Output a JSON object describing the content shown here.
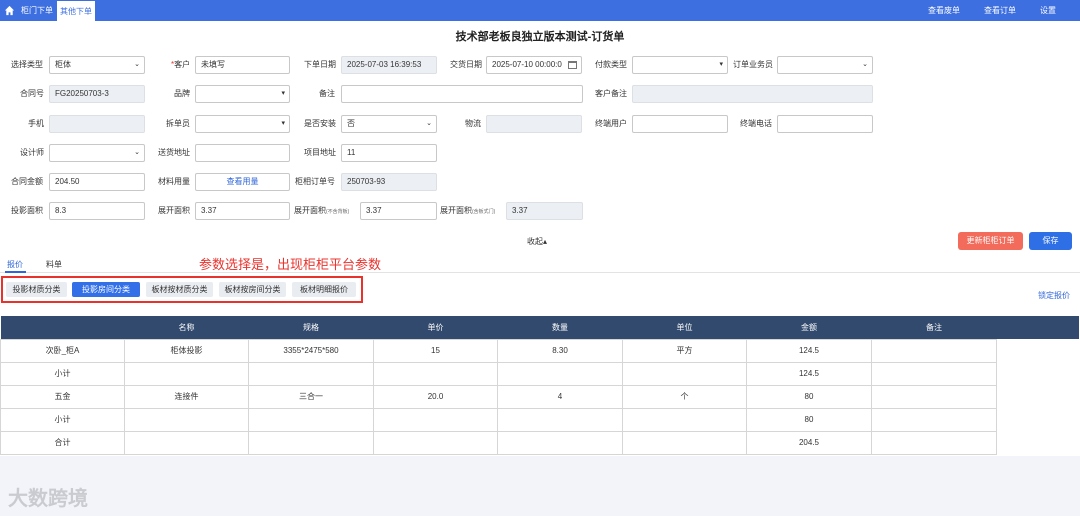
{
  "topbar": {
    "tabs": [
      "柜门下单",
      "其他下单"
    ],
    "links": [
      "查看废单",
      "查看订单",
      "设置"
    ]
  },
  "title": "技术部老板良独立版本测试-订货单",
  "form": {
    "select_type": {
      "label": "选择类型",
      "value": "柜体"
    },
    "customer": {
      "label": "客户",
      "value": "未填写"
    },
    "order_date": {
      "label": "下单日期",
      "value": "2025-07-03 16:39:53"
    },
    "delivery_date": {
      "label": "交货日期",
      "value": "2025-07-10 00:00:0"
    },
    "payment_type": {
      "label": "付款类型",
      "value": ""
    },
    "salesperson": {
      "label": "订单业务员",
      "value": ""
    },
    "contract_no": {
      "label": "合同号",
      "value": "FG20250703-3"
    },
    "brand": {
      "label": "品牌",
      "value": ""
    },
    "remark": {
      "label": "备注",
      "value": ""
    },
    "customer_remark": {
      "label": "客户备注",
      "value": ""
    },
    "phone": {
      "label": "手机",
      "value": ""
    },
    "splitter": {
      "label": "拆单员",
      "value": ""
    },
    "install": {
      "label": "是否安装",
      "value": "否"
    },
    "logistics": {
      "label": "物流",
      "value": ""
    },
    "end_user": {
      "label": "终端用户",
      "value": ""
    },
    "end_phone": {
      "label": "终端电话",
      "value": ""
    },
    "designer": {
      "label": "设计师",
      "value": ""
    },
    "delivery_address": {
      "label": "送货地址",
      "value": ""
    },
    "project_address": {
      "label": "项目地址",
      "value": "11"
    },
    "contract_amount": {
      "label": "合同金额",
      "value": "204.50"
    },
    "material_usage": {
      "label": "材料用量",
      "value": "查看用量"
    },
    "cabinet_order_no": {
      "label": "柜相订单号",
      "value": "250703-93"
    },
    "projection_area": {
      "label": "投影面积",
      "value": "8.3"
    },
    "expand_area": {
      "label": "展开面积",
      "value": "3.37"
    },
    "expand_area2": {
      "label": "展开面积",
      "note": "(不含背板)",
      "value": "3.37"
    },
    "expand_area3": {
      "label": "展开面积",
      "note": "(含板式门)",
      "value": "3.37"
    }
  },
  "collapse_label": "收起▴",
  "buttons": {
    "update": "更新柜柜订单",
    "save": "保存"
  },
  "subtabs": [
    "报价",
    "料单"
  ],
  "annotation": "参数选择是，出现柜柜平台参数",
  "pills": [
    "投影材质分类",
    "投影房间分类",
    "板材按材质分类",
    "板材按房间分类",
    "板材明细报价"
  ],
  "lock_label": "锁定报价",
  "table": {
    "headers": [
      "",
      "名称",
      "规格",
      "单价",
      "数量",
      "单位",
      "金额",
      "备注"
    ],
    "rows": [
      [
        "次卧_柜A",
        "柜体投影",
        "3355*2475*580",
        "15",
        "8.30",
        "平方",
        "124.5",
        ""
      ],
      [
        "小计",
        "",
        "",
        "",
        "",
        "",
        "124.5",
        ""
      ],
      [
        "五金",
        "连接件",
        "三合一",
        "20.0",
        "4",
        "个",
        "80",
        ""
      ],
      [
        "小计",
        "",
        "",
        "",
        "",
        "",
        "80",
        ""
      ],
      [
        "合计",
        "",
        "",
        "",
        "",
        "",
        "204.5",
        ""
      ]
    ]
  },
  "watermark": "大数跨境",
  "colors": {
    "primary": "#3d6fe0",
    "header_dark": "#324a6e",
    "danger": "#f26b5b",
    "annotation": "#e8332d"
  }
}
